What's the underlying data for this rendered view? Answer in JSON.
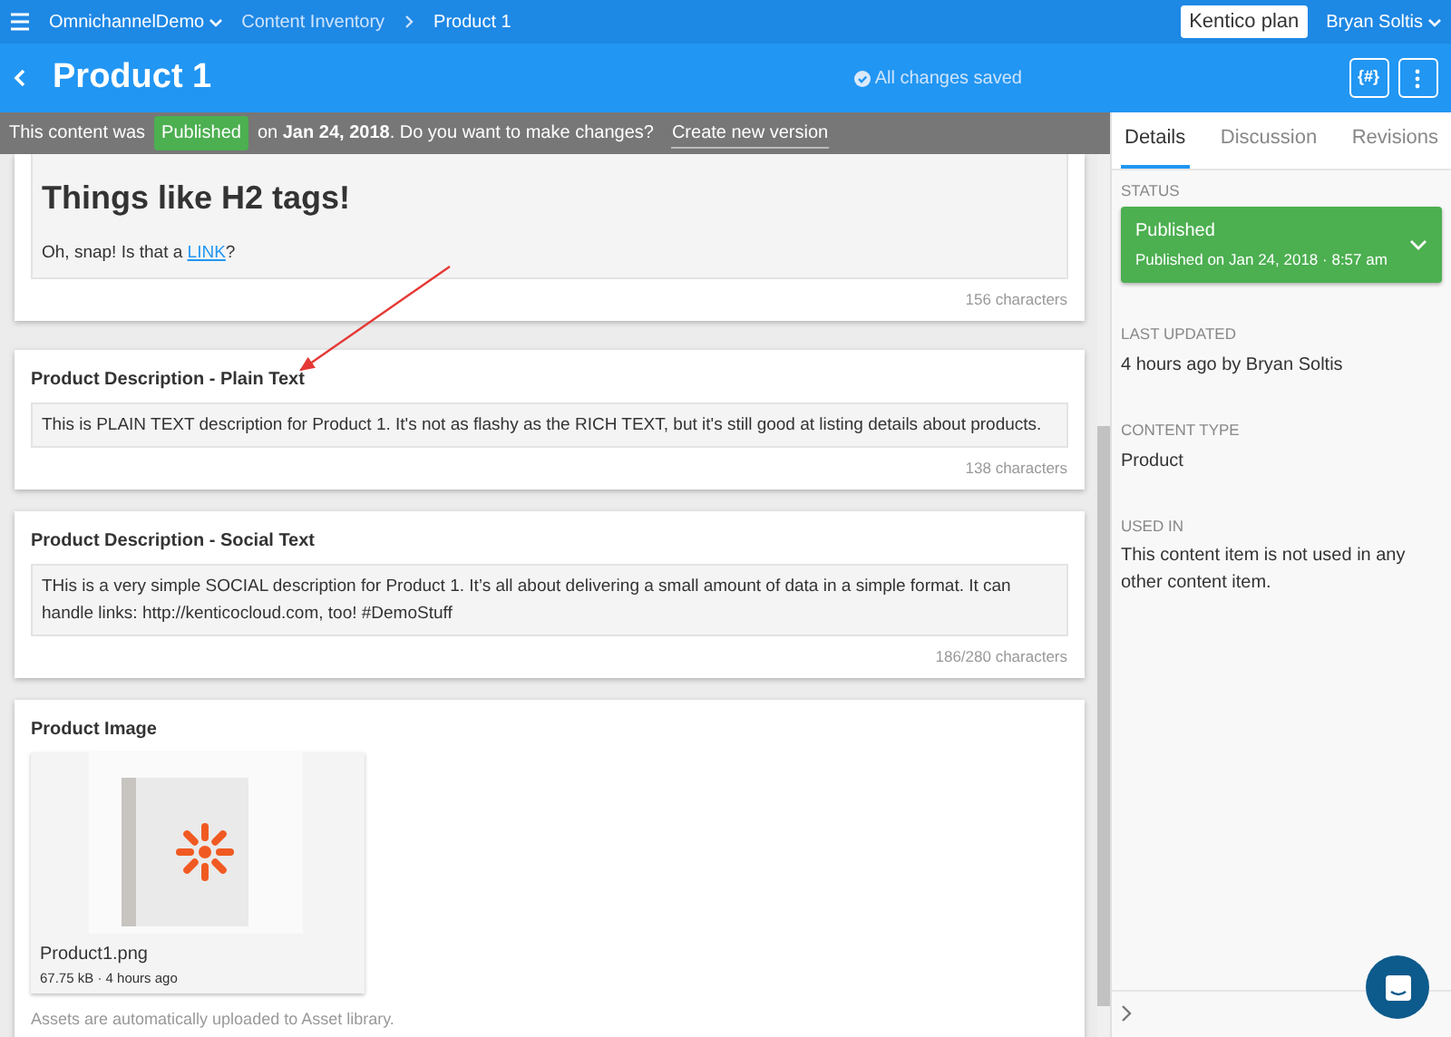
{
  "topbar": {
    "project": "OmnichannelDemo",
    "breadcrumbs": [
      {
        "label": "Content Inventory",
        "current": false
      },
      {
        "label": "Product 1",
        "current": true
      }
    ],
    "plan_button": "Kentico plan",
    "user": "Bryan Soltis"
  },
  "header": {
    "title": "Product 1",
    "save_status": "All changes saved",
    "code_button": "{#}"
  },
  "banner": {
    "prefix": "This content was",
    "status": "Published",
    "text": "on **Jan 24, 2018**. Do you want to make changes?",
    "action": "Create new version"
  },
  "elements": [
    {
      "kind": "rich",
      "heading": "Things like H2 tags!",
      "text_before": "Oh, snap! Is that a",
      "link": "LINK",
      "text_after": "?",
      "counter": "156 characters"
    },
    {
      "kind": "text",
      "label": "Product Description - Plain Text",
      "value": "This is PLAIN TEXT description for Product 1. It's not as flashy as the RICH TEXT, but it's still good at listing details about products.",
      "counter": "138 characters"
    },
    {
      "kind": "text",
      "label": "Product Description - Social Text",
      "value": "THis is a very simple SOCIAL description for Product 1. It’s all about delivering a small amount of data in a simple format. It can handle links: http://kenticocloud.com, too! #DemoStuff",
      "counter": "186/280 characters"
    },
    {
      "kind": "asset",
      "label": "Product Image",
      "filename": "Product1.png",
      "meta": "67.75 kB · 4 hours ago",
      "note": "Assets are automatically uploaded to Asset library."
    }
  ],
  "sidebar": {
    "tabs": [
      {
        "label": "Details",
        "selected": true
      },
      {
        "label": "Discussion",
        "selected": false
      },
      {
        "label": "Revisions",
        "selected": false
      }
    ],
    "status": {
      "label": "STATUS",
      "value": "Published",
      "detail": "Published on Jan 24, 2018 · 8:57 am"
    },
    "sections": [
      {
        "label": "LAST UPDATED",
        "value": "4 hours ago by Bryan Soltis"
      },
      {
        "label": "CONTENT TYPE",
        "value": "Product"
      },
      {
        "label": "USED IN",
        "value": "This content item is not used in any other content item."
      }
    ]
  }
}
